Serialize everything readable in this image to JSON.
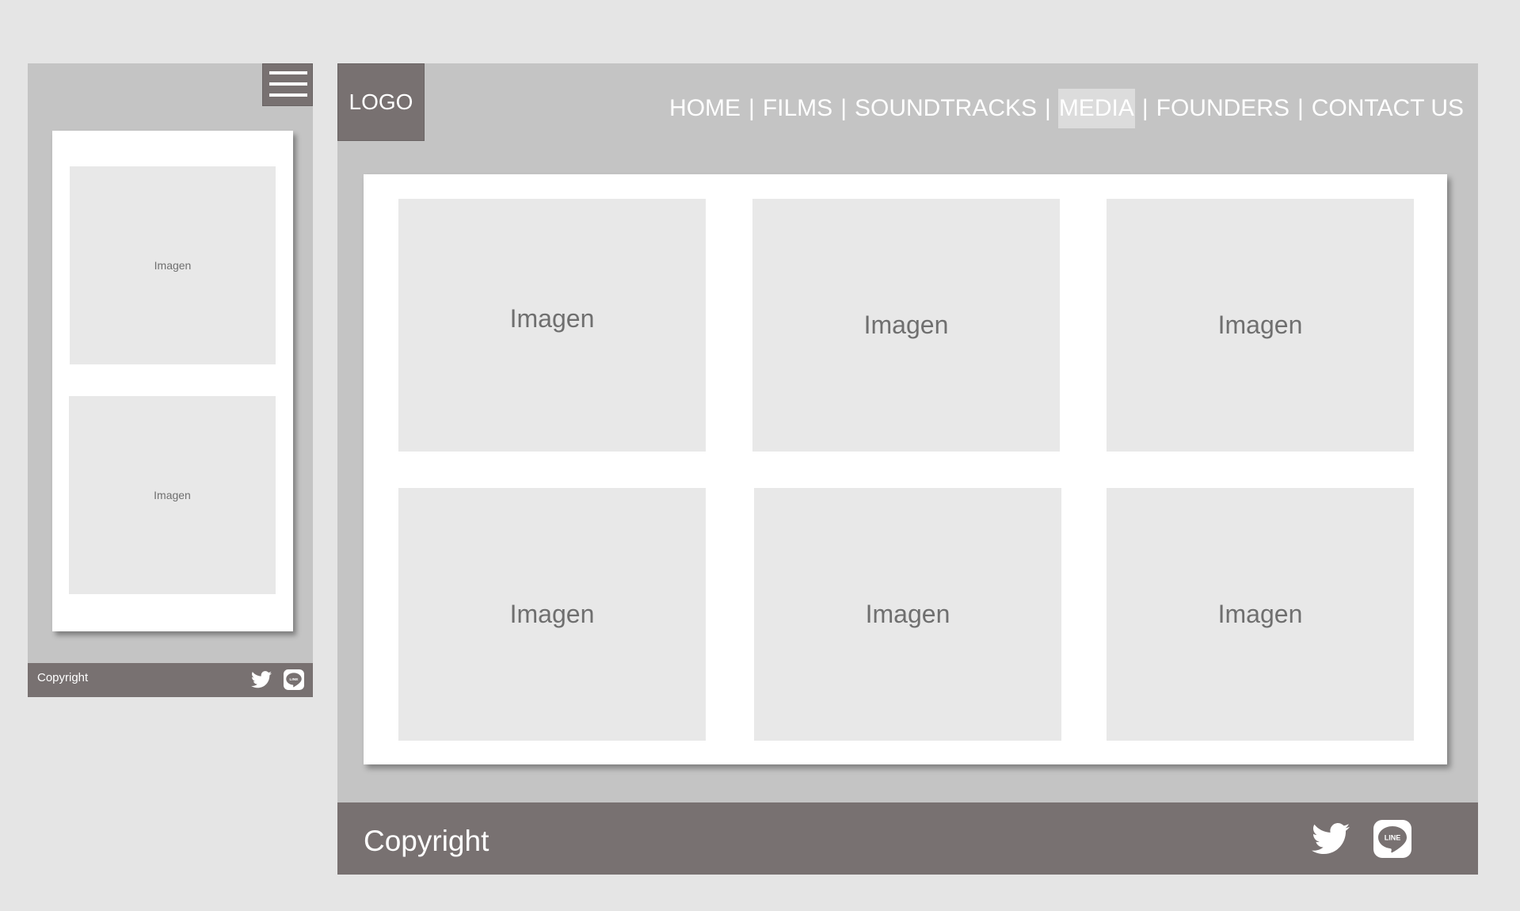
{
  "mobile": {
    "images": [
      "Imagen",
      "Imagen"
    ],
    "footer": {
      "copyright": "Copyright",
      "line_label": "LINE"
    },
    "menu_icon": "hamburger-menu-icon"
  },
  "desktop": {
    "logo": "LOGO",
    "nav": {
      "items": [
        "HOME",
        "FILMS",
        "SOUNDTRACKS",
        "MEDIA",
        "FOUNDERS",
        "CONTACT US"
      ],
      "separator": "|",
      "active": "MEDIA"
    },
    "gallery": [
      "Imagen",
      "Imagen",
      "Imagen",
      "Imagen",
      "Imagen",
      "Imagen"
    ],
    "footer": {
      "copyright": "Copyright",
      "line_label": "LINE"
    }
  },
  "icons": [
    "twitter-icon",
    "line-icon"
  ],
  "colors": {
    "background": "#e5e5e5",
    "panel": "#c4c4c4",
    "dark": "#787171",
    "image_placeholder": "#e8e8e8",
    "active_nav": "#dcdcdc"
  }
}
